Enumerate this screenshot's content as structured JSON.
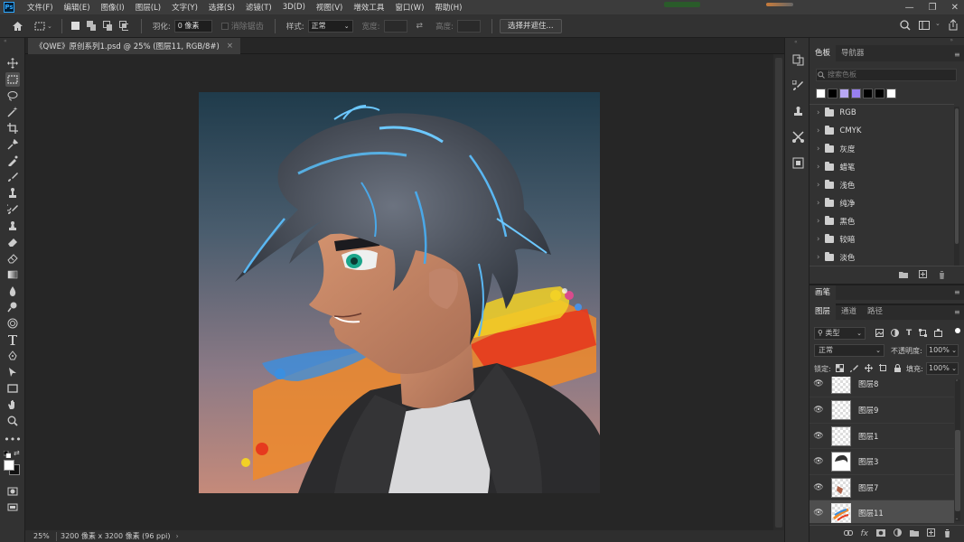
{
  "menubar": {
    "app_icon": "Ps",
    "items": [
      "文件(F)",
      "编辑(E)",
      "图像(I)",
      "图层(L)",
      "文字(Y)",
      "选择(S)",
      "滤镜(T)",
      "3D(D)",
      "视图(V)",
      "增效工具",
      "窗口(W)",
      "帮助(H)"
    ]
  },
  "options": {
    "feather_label": "羽化:",
    "feather_value": "0 像素",
    "antialias_label": "消除锯齿",
    "style_label": "样式:",
    "style_value": "正常",
    "width_label": "宽度:",
    "height_label": "高度:",
    "select_mask_button": "选择并遮住..."
  },
  "document": {
    "tab_title": "《QWE》原创系列1.psd @ 25% (图层11, RGB/8#)",
    "close_label": "×",
    "zoom": "25%",
    "doc_info": "3200 像素 x 3200 像素 (96 ppi)"
  },
  "swatches_panel": {
    "tabs": [
      "色板",
      "导航器"
    ],
    "search_placeholder": "搜索色板",
    "colors": [
      "#ffffff",
      "#000000",
      "#b8a8f5",
      "#9880f0",
      "#000000",
      "#000000",
      "#ffffff"
    ],
    "groups": [
      "RGB",
      "CMYK",
      "灰度",
      "蜡笔",
      "浅色",
      "纯净",
      "黑色",
      "较暗",
      "淡色"
    ]
  },
  "brush_panel": {
    "title": "画笔"
  },
  "layers_panel": {
    "tabs": [
      "图层",
      "通道",
      "路径"
    ],
    "kind_filter": "类型",
    "blend_mode": "正常",
    "opacity_label": "不透明度:",
    "opacity_value": "100%",
    "lock_label": "锁定:",
    "fill_label": "填充:",
    "fill_value": "100%",
    "layers": [
      {
        "name": "图层8",
        "selected": false
      },
      {
        "name": "图层9",
        "selected": false
      },
      {
        "name": "图层1",
        "selected": false
      },
      {
        "name": "图层3",
        "selected": false
      },
      {
        "name": "图层7",
        "selected": false
      },
      {
        "name": "图层11",
        "selected": true
      }
    ]
  },
  "colors": {
    "accent": "#31a8ff",
    "bg": "#262626",
    "panel": "#323232"
  }
}
